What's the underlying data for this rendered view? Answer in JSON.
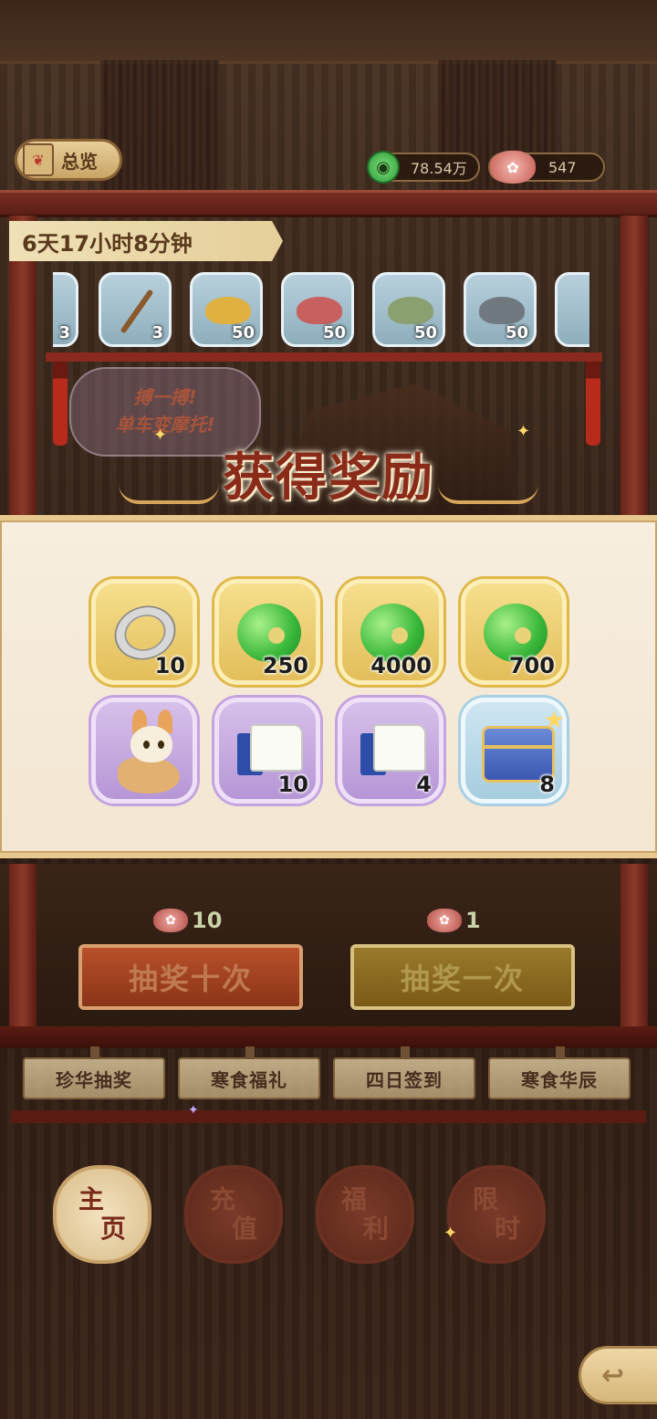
{
  "header": {
    "overview_label": "总览",
    "currencies": [
      {
        "icon": "jade-coin-icon",
        "value": "78.54万"
      },
      {
        "icon": "peony-flower-icon",
        "value": "547"
      }
    ]
  },
  "shop": {
    "countdown": "6天17小时8分钟",
    "items": [
      {
        "icon": "partial-item-icon",
        "qty": "3"
      },
      {
        "icon": "brush-icon",
        "qty": "3"
      },
      {
        "icon": "yellow-sand-icon",
        "qty": "50",
        "color": "#e0b040"
      },
      {
        "icon": "red-sand-icon",
        "qty": "50",
        "color": "#c86060"
      },
      {
        "icon": "green-sand-icon",
        "qty": "50",
        "color": "#8aa070"
      },
      {
        "icon": "gray-sand-icon",
        "qty": "50",
        "color": "#707880"
      }
    ],
    "speech_bubble": [
      "搏一搏!",
      "单车变摩托!"
    ]
  },
  "reward_popup": {
    "title": "获得奖励",
    "rewards": [
      {
        "icon": "silver-bracelet-icon",
        "qty": "10",
        "frame": "gold"
      },
      {
        "icon": "jade-coin-icon",
        "qty": "250",
        "frame": "gold"
      },
      {
        "icon": "jade-coin-icon",
        "qty": "4000",
        "frame": "gold"
      },
      {
        "icon": "jade-coin-icon",
        "qty": "700",
        "frame": "gold"
      },
      {
        "icon": "fox-pet-icon",
        "qty": "",
        "frame": "purple"
      },
      {
        "icon": "scroll-book-icon",
        "qty": "10",
        "frame": "purple"
      },
      {
        "icon": "scroll-book-icon",
        "qty": "4",
        "frame": "purple"
      },
      {
        "icon": "treasure-chest-icon",
        "qty": "8",
        "frame": "blue"
      }
    ]
  },
  "draw": {
    "ten": {
      "cost": "10",
      "label": "抽奖十次"
    },
    "one": {
      "cost": "1",
      "label": "抽奖一次"
    }
  },
  "tabs": [
    "珍华抽奖",
    "寒食福礼",
    "四日签到",
    "寒食华辰"
  ],
  "nav": [
    {
      "top": "主",
      "bottom": "页",
      "active": true
    },
    {
      "top": "充",
      "bottom": "值",
      "active": false
    },
    {
      "top": "福",
      "bottom": "利",
      "active": false
    },
    {
      "top": "限",
      "bottom": "时",
      "active": false
    }
  ],
  "colors": {
    "accent_red": "#8a2a18",
    "panel_bg": "#f7eedf",
    "gold_frame": "#e3be5a",
    "purple_frame": "#b696d6",
    "blue_frame": "#a6cde0"
  }
}
